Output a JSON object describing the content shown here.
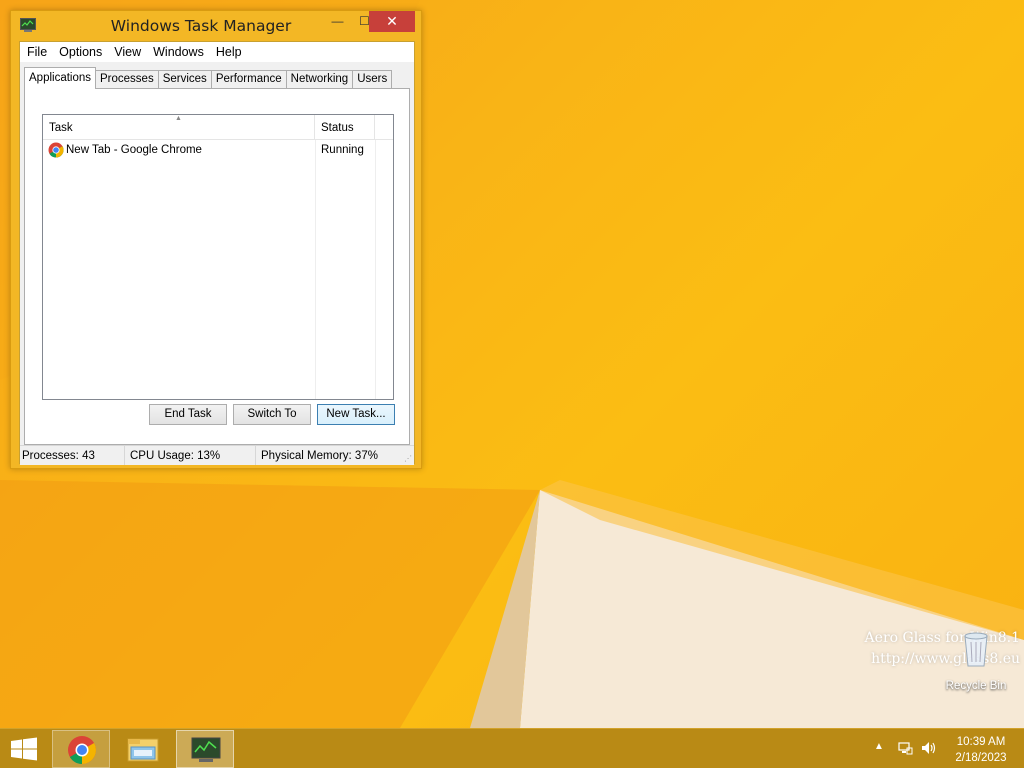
{
  "window": {
    "title": "Windows Task Manager",
    "controls": {
      "minimize": "—",
      "maximize": "☐",
      "close": "✕"
    }
  },
  "menu": [
    "File",
    "Options",
    "View",
    "Windows",
    "Help"
  ],
  "tabs": [
    "Applications",
    "Processes",
    "Services",
    "Performance",
    "Networking",
    "Users"
  ],
  "active_tab": "Applications",
  "task_list": {
    "columns": [
      "Task",
      "Status"
    ],
    "rows": [
      {
        "task": "New Tab - Google Chrome",
        "status": "Running",
        "icon": "chrome-icon"
      }
    ]
  },
  "buttons": {
    "end_task": "End Task",
    "switch_to": "Switch To",
    "new_task": "New Task..."
  },
  "status_bar": {
    "processes": "Processes: 43",
    "cpu": "CPU Usage: 13%",
    "memory": "Physical Memory: 37%"
  },
  "desktop": {
    "watermark_line1": "Aero Glass for Win8.1",
    "watermark_line2": "http://www.glass8.eu",
    "recycle_bin_label": "Recycle Bin"
  },
  "taskbar": {
    "pinned": [
      "chrome-icon",
      "file-explorer-icon",
      "task-manager-icon"
    ],
    "clock_time": "10:39 AM",
    "clock_date": "2/18/2023"
  },
  "colors": {
    "window_frame": "#f3b725",
    "close_button": "#c7403a",
    "taskbar": "#b98a15",
    "desktop": "#f9b416"
  }
}
